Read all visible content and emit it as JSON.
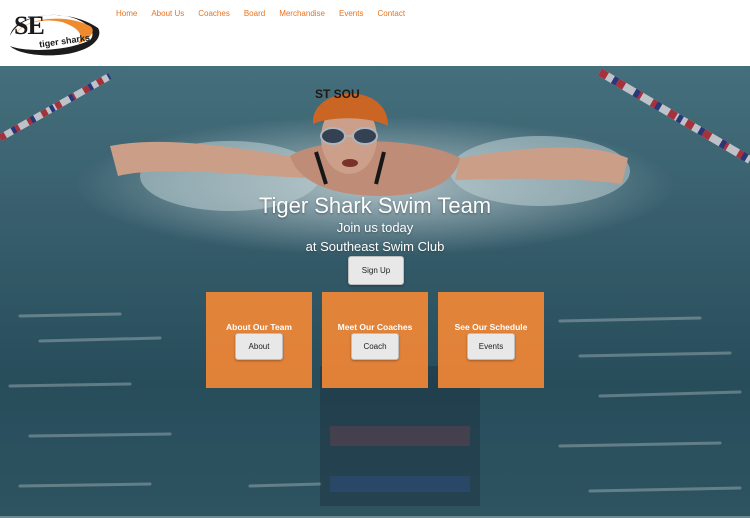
{
  "logo": {
    "initials": "SE",
    "subtitle": "tiger sharks"
  },
  "nav": {
    "items": [
      "Home",
      "About Us",
      "Coaches",
      "Board",
      "Merchandise",
      "Events",
      "Contact"
    ]
  },
  "hero": {
    "title": "Tiger Shark Swim Team",
    "subtitle_line1": "Join us today",
    "subtitle_line2": "at Southeast Swim Club",
    "signup_label": "Sign Up",
    "cap_text": "ST   SOU"
  },
  "cards": [
    {
      "title": "About Our Team",
      "button": "About"
    },
    {
      "title": "Meet Our Coaches",
      "button": "Coach"
    },
    {
      "title": "See Our Schedule",
      "button": "Events"
    }
  ],
  "colors": {
    "accent": "#e8731f",
    "card": "#f08737"
  }
}
